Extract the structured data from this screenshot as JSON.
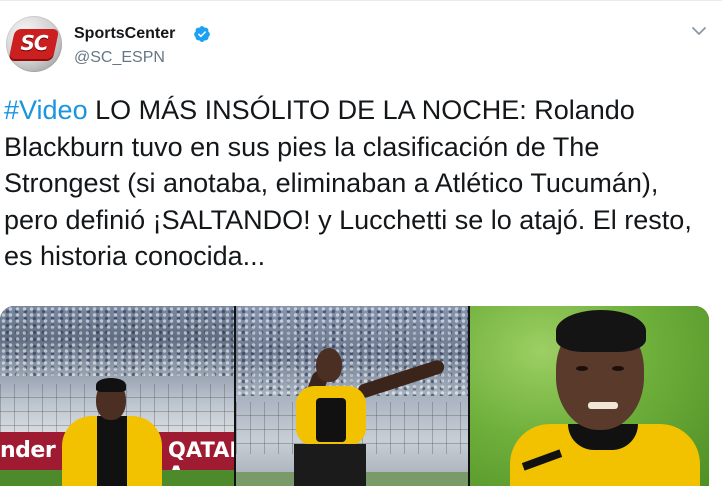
{
  "tweet": {
    "author": {
      "display_name": "SportsCenter",
      "handle": "@SC_ESPN",
      "avatar_text": "SC",
      "verified": true
    },
    "text": {
      "hashtag": "#Video",
      "body": " LO MÁS INSÓLITO DE LA NOCHE: Rolando Blackburn tuvo en sus pies la clasificación de The Strongest (si anotaba, eliminaban a Atlético Tucumán), pero definió ¡SALTANDO! y Lucchetti se lo atajó. El resto, es historia conocida..."
    },
    "media": {
      "ad_left": "nder",
      "ad_right": "QATAR A"
    }
  },
  "colors": {
    "hashtag": "#1b95e0",
    "secondary_text": "#657786",
    "verified": "#1da1f2",
    "jersey_yellow": "#f2c200"
  },
  "icons": [
    "verified-badge-icon",
    "chevron-down-icon"
  ]
}
